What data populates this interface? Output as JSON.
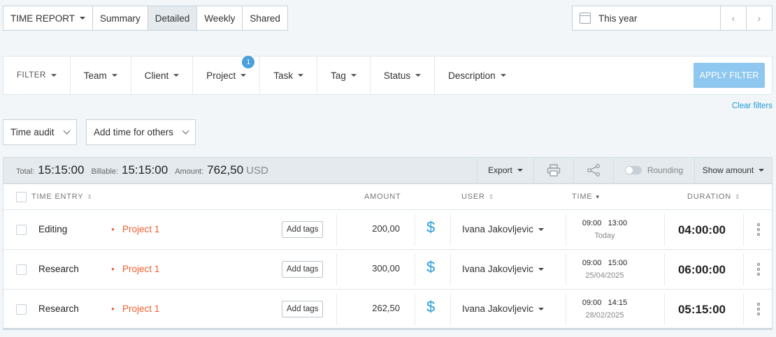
{
  "tabs": {
    "report_label": "TIME REPORT",
    "items": [
      "Summary",
      "Detailed",
      "Weekly",
      "Shared"
    ]
  },
  "date": {
    "label": "This year",
    "prev": "‹",
    "next": "›"
  },
  "filters": {
    "filter_label": "FILTER",
    "items": [
      "Team",
      "Client",
      "Project",
      "Task",
      "Tag",
      "Status",
      "Description"
    ],
    "project_badge": "1",
    "apply_label": "APPLY FILTER",
    "clear_label": "Clear filters"
  },
  "actions": {
    "time_audit": "Time audit",
    "add_time": "Add time for others"
  },
  "summary": {
    "total_label": "Total:",
    "total": "15:15:00",
    "billable_label": "Billable:",
    "billable": "15:15:00",
    "amount_label": "Amount:",
    "amount": "762,50",
    "currency": "USD",
    "export": "Export",
    "rounding": "Rounding",
    "show_amount": "Show amount"
  },
  "table": {
    "headers": {
      "entry": "TIME ENTRY",
      "amount": "AMOUNT",
      "user": "USER",
      "time": "TIME",
      "duration": "DURATION"
    },
    "tags_label": "Add tags",
    "dollar": "$",
    "rows": [
      {
        "desc": "Editing",
        "project": "Project 1",
        "amount": "200,00",
        "user": "Ivana Jakovljevic",
        "start": "09:00",
        "end": "13:00",
        "date": "Today",
        "duration": "04:00:00"
      },
      {
        "desc": "Research",
        "project": "Project 1",
        "amount": "300,00",
        "user": "Ivana Jakovljevic",
        "start": "09:00",
        "end": "15:00",
        "date": "25/04/2025",
        "duration": "06:00:00"
      },
      {
        "desc": "Research",
        "project": "Project 1",
        "amount": "262,50",
        "user": "Ivana Jakovljevic",
        "start": "09:00",
        "end": "14:15",
        "date": "28/02/2025",
        "duration": "05:15:00"
      }
    ]
  },
  "colors": {
    "accent": "#2a9ddc",
    "project": "#f05d2e",
    "apply": "#8ec7ef",
    "badge": "#4aa0db"
  }
}
